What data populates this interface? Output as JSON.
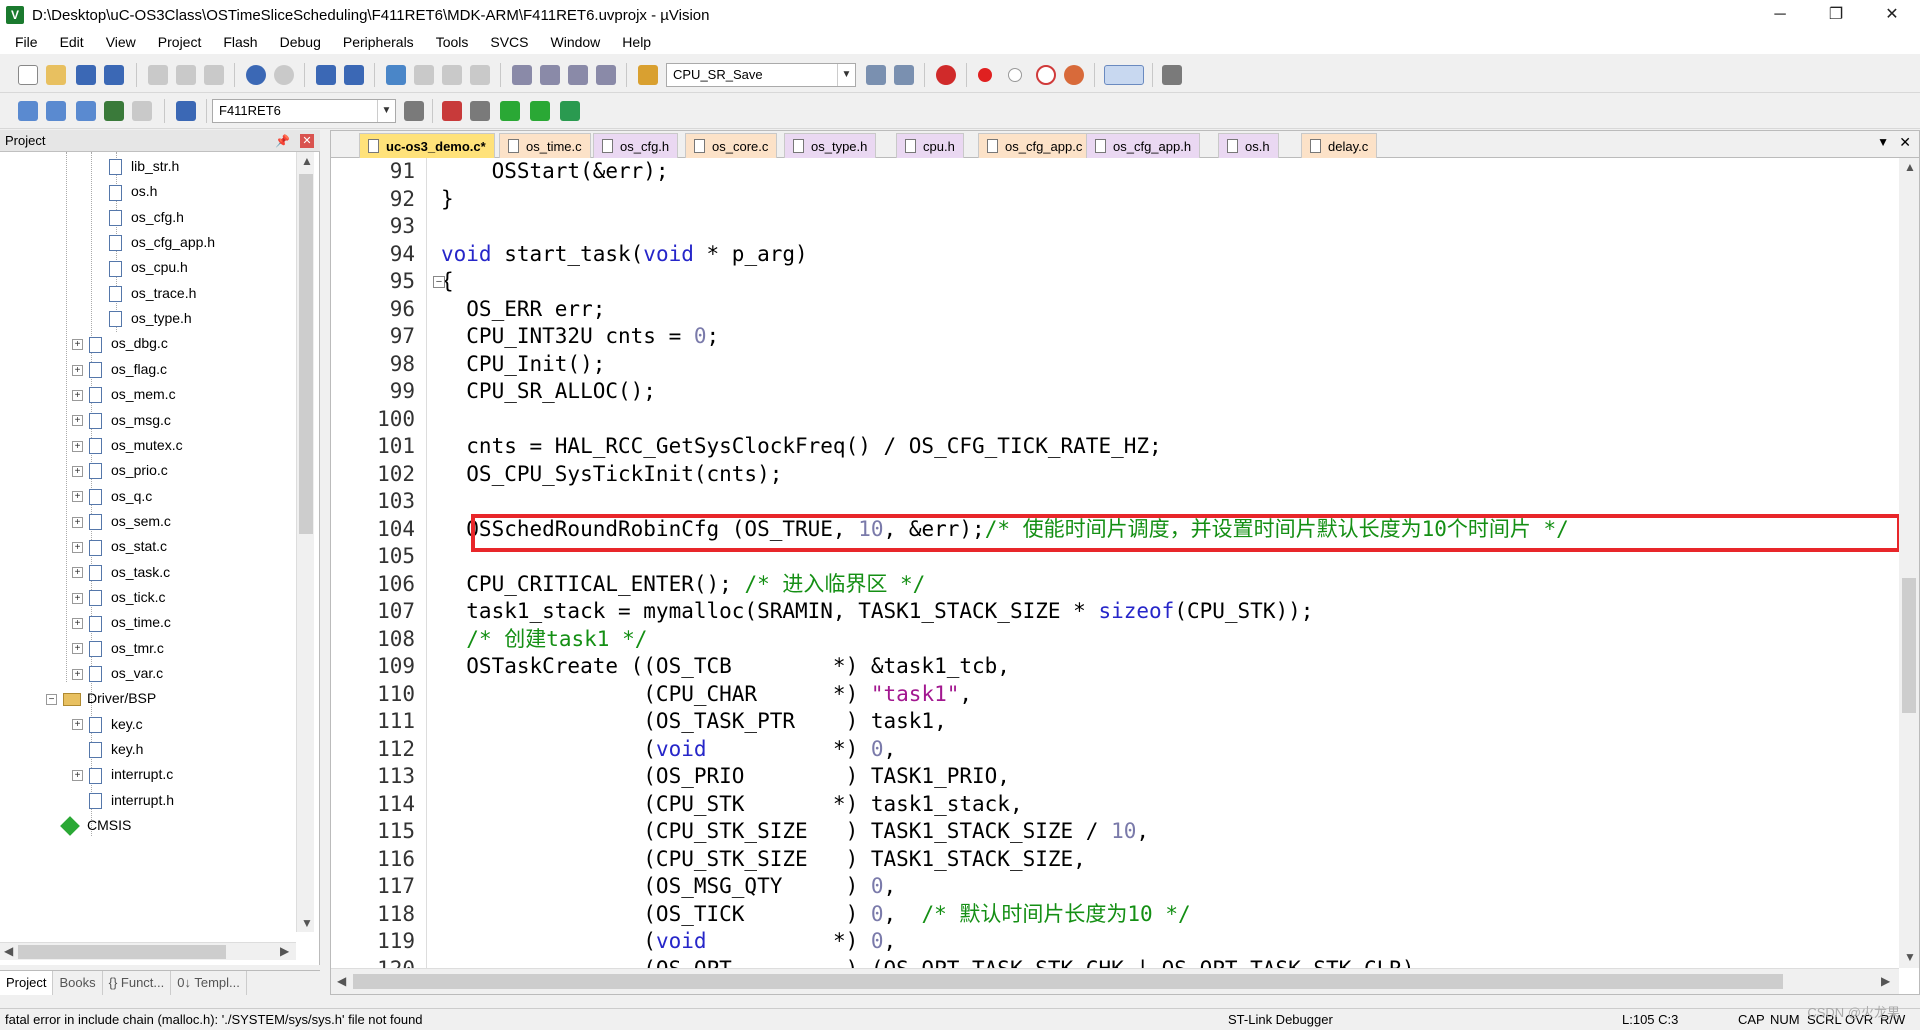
{
  "window": {
    "title": "D:\\Desktop\\uC-OS3Class\\OSTimeSliceScheduling\\F411RET6\\MDK-ARM\\F411RET6.uvprojx - µVision",
    "minimize": "─",
    "maximize": "❐",
    "close": "✕"
  },
  "menu": [
    "File",
    "Edit",
    "View",
    "Project",
    "Flash",
    "Debug",
    "Peripherals",
    "Tools",
    "SVCS",
    "Window",
    "Help"
  ],
  "toolbar": {
    "find_combo": "CPU_SR_Save",
    "target_combo": "F411RET6"
  },
  "project_panel": {
    "header": "Project",
    "pin": "📌",
    "close": "✕",
    "tree": [
      {
        "label": "lib_str.h",
        "type": "file",
        "level": 2,
        "expander": ""
      },
      {
        "label": "os.h",
        "type": "file",
        "level": 2,
        "expander": ""
      },
      {
        "label": "os_cfg.h",
        "type": "file",
        "level": 2,
        "expander": ""
      },
      {
        "label": "os_cfg_app.h",
        "type": "file",
        "level": 2,
        "expander": ""
      },
      {
        "label": "os_cpu.h",
        "type": "file",
        "level": 2,
        "expander": ""
      },
      {
        "label": "os_trace.h",
        "type": "file",
        "level": 2,
        "expander": ""
      },
      {
        "label": "os_type.h",
        "type": "file",
        "level": 2,
        "expander": ""
      },
      {
        "label": "os_dbg.c",
        "type": "file",
        "level": 1,
        "expander": "+"
      },
      {
        "label": "os_flag.c",
        "type": "file",
        "level": 1,
        "expander": "+"
      },
      {
        "label": "os_mem.c",
        "type": "file",
        "level": 1,
        "expander": "+"
      },
      {
        "label": "os_msg.c",
        "type": "file",
        "level": 1,
        "expander": "+"
      },
      {
        "label": "os_mutex.c",
        "type": "file",
        "level": 1,
        "expander": "+"
      },
      {
        "label": "os_prio.c",
        "type": "file",
        "level": 1,
        "expander": "+"
      },
      {
        "label": "os_q.c",
        "type": "file",
        "level": 1,
        "expander": "+"
      },
      {
        "label": "os_sem.c",
        "type": "file",
        "level": 1,
        "expander": "+"
      },
      {
        "label": "os_stat.c",
        "type": "file",
        "level": 1,
        "expander": "+"
      },
      {
        "label": "os_task.c",
        "type": "file",
        "level": 1,
        "expander": "+"
      },
      {
        "label": "os_tick.c",
        "type": "file",
        "level": 1,
        "expander": "+"
      },
      {
        "label": "os_time.c",
        "type": "file",
        "level": 1,
        "expander": "+"
      },
      {
        "label": "os_tmr.c",
        "type": "file",
        "level": 1,
        "expander": "+"
      },
      {
        "label": "os_var.c",
        "type": "file",
        "level": 1,
        "expander": "+"
      },
      {
        "label": "Driver/BSP",
        "type": "folder",
        "level": 0,
        "expander": "−"
      },
      {
        "label": "key.c",
        "type": "file",
        "level": 1,
        "expander": "+"
      },
      {
        "label": "key.h",
        "type": "file",
        "level": 1,
        "expander": ""
      },
      {
        "label": "interrupt.c",
        "type": "file",
        "level": 1,
        "expander": "+"
      },
      {
        "label": "interrupt.h",
        "type": "file",
        "level": 1,
        "expander": ""
      },
      {
        "label": "CMSIS",
        "type": "component",
        "level": 0,
        "expander": ""
      }
    ],
    "bottom_tabs": [
      "Project",
      "Books",
      "{} Funct...",
      "0↓ Templ..."
    ]
  },
  "editor": {
    "tabs": [
      {
        "label": "uc-os3_demo.c*",
        "kind": "active"
      },
      {
        "label": "os_time.c",
        "kind": "c"
      },
      {
        "label": "os_cfg.h",
        "kind": "h"
      },
      {
        "label": "os_core.c",
        "kind": "c"
      },
      {
        "label": "os_type.h",
        "kind": "h"
      },
      {
        "label": "cpu.h",
        "kind": "h"
      },
      {
        "label": "os_cfg_app.c",
        "kind": "c"
      },
      {
        "label": "os_cfg_app.h",
        "kind": "h"
      },
      {
        "label": "os.h",
        "kind": "h"
      },
      {
        "label": "delay.c",
        "kind": "c"
      }
    ],
    "highlighted_line": "104",
    "lines": [
      {
        "n": "91",
        "t": [
          [
            "",
            "    OSStart(&err);"
          ]
        ]
      },
      {
        "n": "92",
        "t": [
          [
            "",
            "}"
          ]
        ]
      },
      {
        "n": "93",
        "t": [
          [
            "",
            ""
          ]
        ]
      },
      {
        "n": "94",
        "t": [
          [
            "kw",
            "void"
          ],
          [
            "",
            " start_task("
          ],
          [
            "kw",
            "void"
          ],
          [
            "",
            " * p_arg)"
          ]
        ]
      },
      {
        "n": "95",
        "t": [
          [
            "",
            "{"
          ]
        ],
        "fold": "−"
      },
      {
        "n": "96",
        "t": [
          [
            "",
            "  OS_ERR err;"
          ]
        ]
      },
      {
        "n": "97",
        "t": [
          [
            "",
            "  CPU_INT32U cnts = "
          ],
          [
            "num",
            "0"
          ],
          [
            "",
            ";"
          ]
        ]
      },
      {
        "n": "98",
        "t": [
          [
            "",
            "  CPU_Init();"
          ]
        ]
      },
      {
        "n": "99",
        "t": [
          [
            "",
            "  CPU_SR_ALLOC();"
          ]
        ]
      },
      {
        "n": "100",
        "t": [
          [
            "",
            ""
          ]
        ]
      },
      {
        "n": "101",
        "t": [
          [
            "",
            "  cnts = HAL_RCC_GetSysClockFreq() / OS_CFG_TICK_RATE_HZ;"
          ]
        ]
      },
      {
        "n": "102",
        "t": [
          [
            "",
            "  OS_CPU_SysTickInit(cnts);"
          ]
        ]
      },
      {
        "n": "103",
        "t": [
          [
            "",
            ""
          ]
        ]
      },
      {
        "n": "104",
        "t": [
          [
            "",
            "  OSSchedRoundRobinCfg (OS_TRUE, "
          ],
          [
            "num",
            "10"
          ],
          [
            "",
            ", &err);"
          ],
          [
            "cm",
            "/* 使能时间片调度，并设置时间片默认长度为10个时间片 */"
          ]
        ]
      },
      {
        "n": "105",
        "t": [
          [
            "",
            ""
          ]
        ]
      },
      {
        "n": "106",
        "t": [
          [
            "",
            "  CPU_CRITICAL_ENTER(); "
          ],
          [
            "cm",
            "/* 进入临界区 */"
          ]
        ]
      },
      {
        "n": "107",
        "t": [
          [
            "",
            "  task1_stack = mymalloc(SRAMIN, TASK1_STACK_SIZE * "
          ],
          [
            "kw",
            "sizeof"
          ],
          [
            "",
            "(CPU_STK));"
          ]
        ]
      },
      {
        "n": "108",
        "t": [
          [
            "",
            "  "
          ],
          [
            "cm",
            "/* 创建task1 */"
          ]
        ]
      },
      {
        "n": "109",
        "t": [
          [
            "",
            "  OSTaskCreate ((OS_TCB        *) &task1_tcb,"
          ]
        ]
      },
      {
        "n": "110",
        "t": [
          [
            "",
            "                (CPU_CHAR      *) "
          ],
          [
            "str",
            "\"task1\""
          ],
          [
            "",
            ","
          ]
        ]
      },
      {
        "n": "111",
        "t": [
          [
            "",
            "                (OS_TASK_PTR    ) task1,"
          ]
        ]
      },
      {
        "n": "112",
        "t": [
          [
            "",
            "                ("
          ],
          [
            "kw",
            "void"
          ],
          [
            "",
            "          *) "
          ],
          [
            "num",
            "0"
          ],
          [
            "",
            ","
          ]
        ]
      },
      {
        "n": "113",
        "t": [
          [
            "",
            "                (OS_PRIO        ) TASK1_PRIO,"
          ]
        ]
      },
      {
        "n": "114",
        "t": [
          [
            "",
            "                (CPU_STK       *) task1_stack,"
          ]
        ]
      },
      {
        "n": "115",
        "t": [
          [
            "",
            "                (CPU_STK_SIZE   ) TASK1_STACK_SIZE / "
          ],
          [
            "num",
            "10"
          ],
          [
            "",
            ","
          ]
        ]
      },
      {
        "n": "116",
        "t": [
          [
            "",
            "                (CPU_STK_SIZE   ) TASK1_STACK_SIZE,"
          ]
        ]
      },
      {
        "n": "117",
        "t": [
          [
            "",
            "                (OS_MSG_QTY     ) "
          ],
          [
            "num",
            "0"
          ],
          [
            "",
            ","
          ]
        ]
      },
      {
        "n": "118",
        "t": [
          [
            "",
            "                (OS_TICK        ) "
          ],
          [
            "num",
            "0"
          ],
          [
            "",
            ",  "
          ],
          [
            "cm",
            "/* 默认时间片长度为10 */"
          ]
        ]
      },
      {
        "n": "119",
        "t": [
          [
            "",
            "                ("
          ],
          [
            "kw",
            "void"
          ],
          [
            "",
            "          *) "
          ],
          [
            "num",
            "0"
          ],
          [
            "",
            ","
          ]
        ]
      },
      {
        "n": "120",
        "t": [
          [
            "",
            "                (OS_OPT         ) (OS_OPT_TASK_STK_CHK | OS_OPT_TASK_STK_CLR),"
          ]
        ]
      }
    ]
  },
  "status": {
    "message": "fatal error in include chain (malloc.h): './SYSTEM/sys/sys.h' file not found",
    "debugger": "ST-Link Debugger",
    "position": "L:105 C:3",
    "cap": "CAP",
    "num": "NUM",
    "scrl": "SCRL",
    "ovr": "OVR",
    "rw": "R/W"
  },
  "watermark": "CSDN @火龙果"
}
